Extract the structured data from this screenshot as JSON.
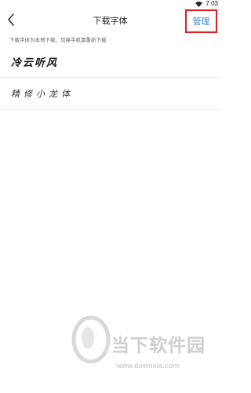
{
  "status_bar": {
    "time": "7:03"
  },
  "nav": {
    "title": "下载字体",
    "manage_label": "管理"
  },
  "hint": "下载字体为本地下载，切换手机需重新下载",
  "fonts": [
    {
      "name": "冷云听风"
    },
    {
      "name": "精修小龙体"
    }
  ],
  "watermark": {
    "brand": "当下软件园",
    "url": "www.downxia.com"
  },
  "colors": {
    "accent": "#3a87d8",
    "highlight_border": "#e02020"
  }
}
